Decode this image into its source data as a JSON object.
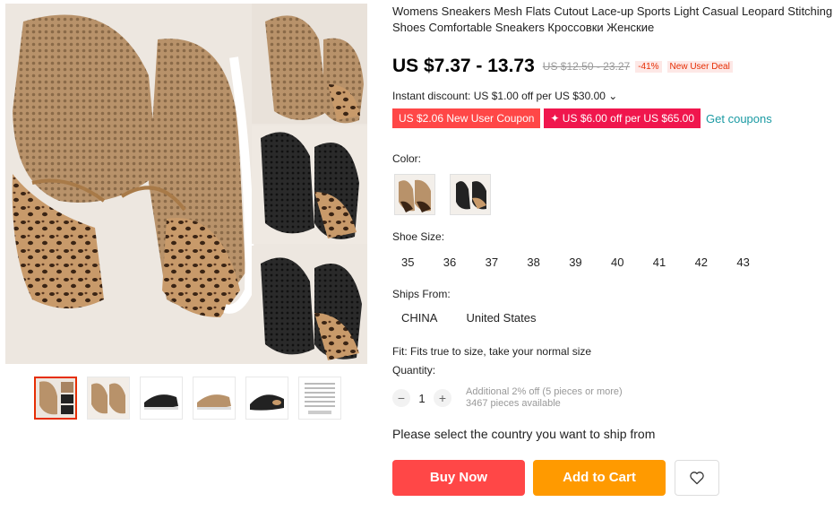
{
  "product": {
    "title": "Womens Sneakers Mesh Flats Cutout Lace-up Sports Light Casual Leopard Stitching Shoes Comfortable Sneakers Кроссовки Женские"
  },
  "price": {
    "current": "US $7.37 - 13.73",
    "original": "US $12.50 - 23.27",
    "discount": "-41%",
    "deal_badge": "New User Deal"
  },
  "instant_discount": "Instant discount: US $1.00 off per US $30.00 ⌄",
  "coupons": {
    "items": [
      "US $2.06 New User Coupon",
      "✦ US $6.00 off per US $65.00"
    ],
    "get_label": "Get coupons"
  },
  "color": {
    "label": "Color:",
    "options": [
      "beige-leopard",
      "black-leopard"
    ]
  },
  "shoe_size": {
    "label": "Shoe Size:",
    "options": [
      "35",
      "36",
      "37",
      "38",
      "39",
      "40",
      "41",
      "42",
      "43"
    ]
  },
  "ships_from": {
    "label": "Ships From:",
    "options": [
      "CHINA",
      "United States"
    ]
  },
  "fit_text": "Fit: Fits true to size, take your normal size",
  "quantity": {
    "label": "Quantity:",
    "minus": "−",
    "value": "1",
    "plus": "+",
    "promo": "Additional 2% off (5 pieces or more)",
    "available": "3467 pieces available"
  },
  "select_country_text": "Please select the country you want to ship from",
  "actions": {
    "buy_now": "Buy Now",
    "add_to_cart": "Add to Cart",
    "wishlist_icon": "heart-icon"
  },
  "colors": {
    "price_red": "#e62e04",
    "buy_button": "#ff4747",
    "cart_button": "#ff9a00",
    "coupon_red": "#ff4747",
    "coupon_pink": "#f0164d",
    "link_teal": "#1a9aa3"
  },
  "gallery": {
    "thumbnail_count": 6,
    "selected_thumbnail": 1
  }
}
